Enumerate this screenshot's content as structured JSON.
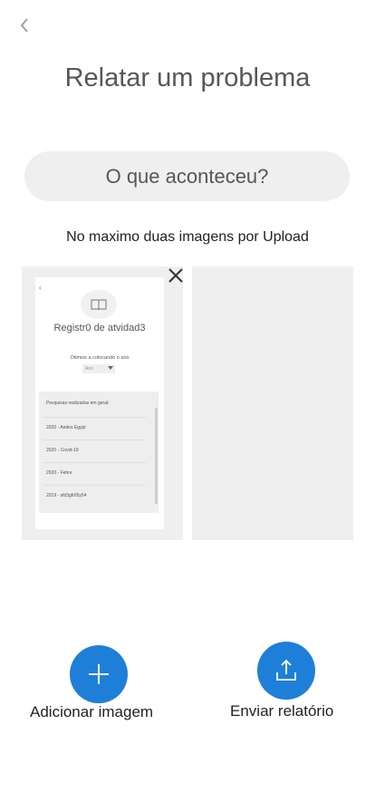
{
  "header": {
    "back_icon": "chevron-left-icon",
    "title": "Relatar um problema"
  },
  "question_button": {
    "label": "O que aconteceu?"
  },
  "upload_hint": "No maximo duas imagens por Upload",
  "images": {
    "remove_icon": "close-icon",
    "slot1": {
      "preview": {
        "back_icon": "chevron-left-icon",
        "book_icon": "book-icon",
        "title": "Registr0 de atvidad3",
        "filter_label": "Otimize a  colocando o ano",
        "year_select": {
          "placeholder": "Ano",
          "icon": "triangle-down-icon"
        },
        "list_header": "Pesquisas realizadas em geral:",
        "items": [
          "2020 - Aedes Egypt",
          "2020 - Covid-19",
          "2020 - Febre",
          "2019 - sfd3gfr65y54"
        ]
      }
    },
    "slot2": {
      "empty": true
    }
  },
  "actions": {
    "add": {
      "label": "Adicionar imagem",
      "icon": "plus-icon"
    },
    "send": {
      "label": "Enviar relatório",
      "icon": "upload-icon"
    }
  },
  "colors": {
    "accent": "#1e7fd9",
    "surface": "#efefef",
    "text_muted": "#575757"
  }
}
